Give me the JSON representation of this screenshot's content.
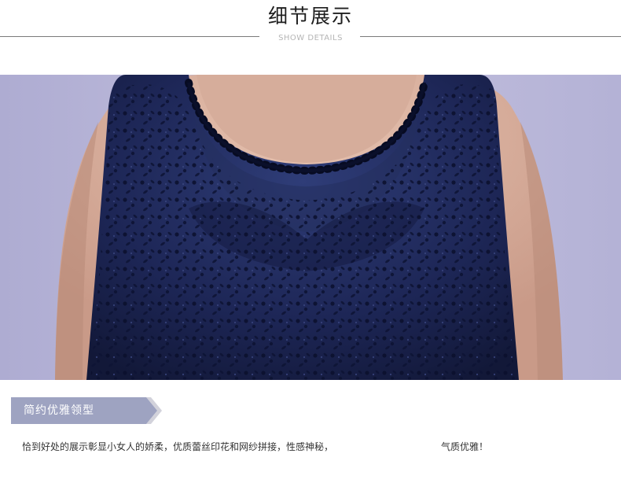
{
  "header": {
    "title": "细节展示",
    "subtitle": "SHOW DETAILS"
  },
  "photo": {
    "description_icon": "dress-neckline-photo",
    "colors": {
      "background": "#b9b8d8",
      "skin": "#ddb8a6",
      "dress": "#1f2a55",
      "lace": "#0b1030"
    }
  },
  "section": {
    "label": "简约优雅领型",
    "label_bg": "#9fa4c0"
  },
  "description": {
    "text": "恰到好处的展示彰显小女人的娇柔，优质蕾丝印花和网纱拼接，性感神秘，",
    "text_end": "气质优雅！"
  }
}
